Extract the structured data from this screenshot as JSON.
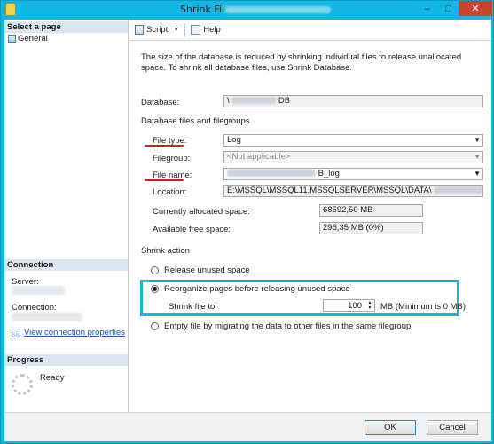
{
  "window": {
    "title": "Shrink File - ",
    "minimize": "–",
    "maximize": "□",
    "close": "✕"
  },
  "left": {
    "select_page": "Select a page",
    "general": "General",
    "connection": "Connection",
    "server_label": "Server:",
    "connection_label": "Connection:",
    "view_connection": "View connection properties",
    "progress": "Progress",
    "ready": "Ready"
  },
  "toolbar": {
    "script": "Script",
    "help": "Help"
  },
  "main": {
    "description": "The size of the database is reduced by shrinking individual files to release unallocated space. To shrink all database files, use Shrink Database.",
    "database_label": "Database:",
    "database_prefix": "\\",
    "database_suffix": "DB",
    "files_header": "Database files and filegroups",
    "file_type_label": "File type:",
    "file_type_value": "Log",
    "filegroup_label": "Filegroup:",
    "filegroup_value": "<Not applicable>",
    "file_name_label": "File name:",
    "file_name_suffix": "B_log",
    "location_label": "Location:",
    "location_value": "E:\\MSSQL\\MSSQL11.MSSQLSERVER\\MSSQL\\DATA\\",
    "allocated_label": "Currently allocated space:",
    "allocated_value": "68592,50 MB",
    "free_label": "Available free space:",
    "free_value": "296,35 MB (0%)",
    "shrink_action_header": "Shrink action",
    "opt_release": "Release unused space",
    "opt_reorganize": "Reorganize pages before releasing unused space",
    "shrink_to_label": "Shrink file to:",
    "shrink_to_value": "100",
    "shrink_to_unit": "MB (Minimum is 0 MB)",
    "opt_empty": "Empty file by migrating the data to other files in the same filegroup"
  },
  "footer": {
    "ok": "OK",
    "cancel": "Cancel"
  }
}
